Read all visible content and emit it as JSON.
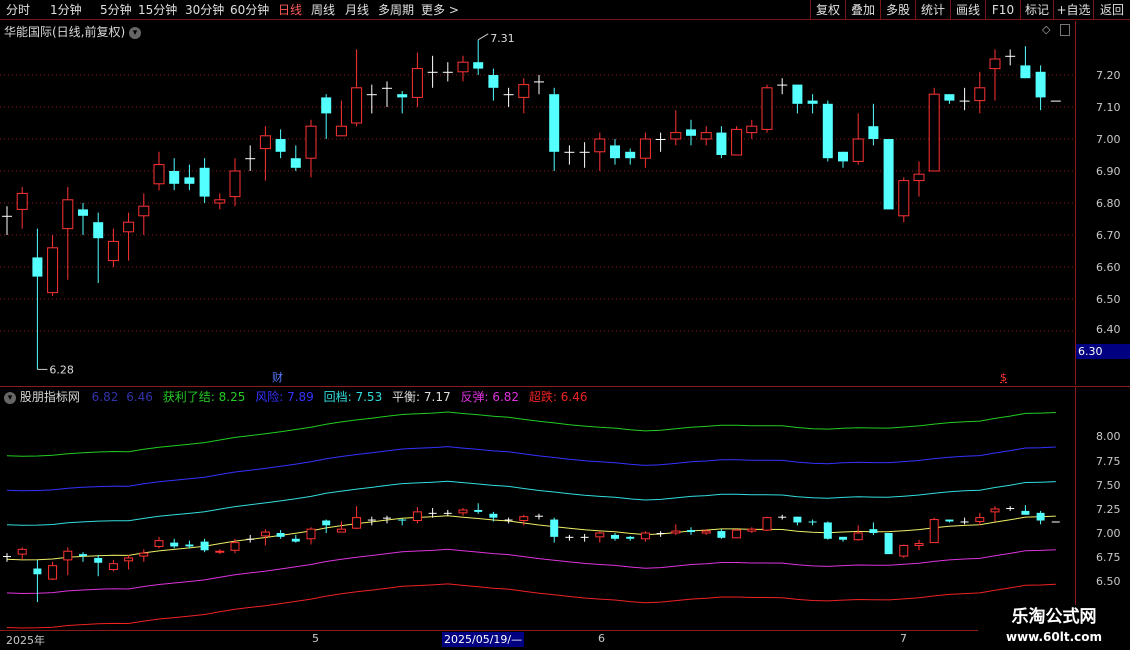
{
  "toolbar": {
    "periods": [
      "分时",
      "1分钟",
      "5分钟",
      "15分钟",
      "30分钟",
      "60分钟",
      "日线",
      "周线",
      "月线",
      "多周期",
      "更多 >"
    ],
    "active_period": "日线",
    "actions": [
      "复权",
      "叠加",
      "多股",
      "统计",
      "画线",
      "F10",
      "标记",
      "+自选",
      "返回"
    ]
  },
  "price_panel": {
    "title": "华能国际(日线,前复权)",
    "axis_labels": [
      "7.20",
      "7.10",
      "7.00",
      "6.90",
      "6.80",
      "6.70",
      "6.60",
      "6.50",
      "6.40"
    ],
    "cursor_value": "6.30",
    "high_label": "7.31",
    "low_label": "6.28",
    "marker_cai": "财",
    "marker_dollar": "$"
  },
  "indicator_panel": {
    "name": "股朋指标网",
    "pre_values": [
      "6.82",
      "6.46"
    ],
    "lines": [
      {
        "label": "获利了结",
        "value": "8.25",
        "color": "#22cc22"
      },
      {
        "label": "风险",
        "value": "7.89",
        "color": "#3333ff"
      },
      {
        "label": "回档",
        "value": "7.53",
        "color": "#33dddd"
      },
      {
        "label": "平衡",
        "value": "7.17",
        "color": "#dddd55"
      },
      {
        "label": "反弹",
        "value": "6.82",
        "color": "#dd33dd"
      },
      {
        "label": "超跌",
        "value": "6.46",
        "color": "#ee2222"
      }
    ],
    "axis_labels": [
      "8.00",
      "7.75",
      "7.50",
      "7.25",
      "7.00",
      "6.75",
      "6.50"
    ]
  },
  "date_bar": {
    "labels": [
      "2025年",
      "5",
      "6",
      "7"
    ],
    "cursor_date": "2025/05/19/—"
  },
  "watermark": {
    "line1": "乐淘公式网",
    "line2": "www.60lt.com"
  },
  "colors": {
    "up": "#ff3333",
    "down": "#54ffff",
    "doji": "#ffffff",
    "grid": "#8b1a1a"
  },
  "chart_data": {
    "type": "candlestick",
    "price_ylim": [
      6.28,
      7.31
    ],
    "candles": [
      {
        "o": 6.76,
        "c": 6.76,
        "h": 6.79,
        "l": 6.7
      },
      {
        "o": 6.78,
        "c": 6.83,
        "h": 6.85,
        "l": 6.72
      },
      {
        "o": 6.63,
        "c": 6.57,
        "h": 6.72,
        "l": 6.28
      },
      {
        "o": 6.52,
        "c": 6.66,
        "h": 6.7,
        "l": 6.51
      },
      {
        "o": 6.72,
        "c": 6.81,
        "h": 6.85,
        "l": 6.56
      },
      {
        "o": 6.78,
        "c": 6.76,
        "h": 6.8,
        "l": 6.7
      },
      {
        "o": 6.74,
        "c": 6.69,
        "h": 6.77,
        "l": 6.55
      },
      {
        "o": 6.62,
        "c": 6.68,
        "h": 6.72,
        "l": 6.6
      },
      {
        "o": 6.71,
        "c": 6.74,
        "h": 6.77,
        "l": 6.62
      },
      {
        "o": 6.76,
        "c": 6.79,
        "h": 6.83,
        "l": 6.7
      },
      {
        "o": 6.86,
        "c": 6.92,
        "h": 6.96,
        "l": 6.84
      },
      {
        "o": 6.9,
        "c": 6.86,
        "h": 6.94,
        "l": 6.84
      },
      {
        "o": 6.88,
        "c": 6.86,
        "h": 6.92,
        "l": 6.84
      },
      {
        "o": 6.91,
        "c": 6.82,
        "h": 6.94,
        "l": 6.8
      },
      {
        "o": 6.8,
        "c": 6.81,
        "h": 6.83,
        "l": 6.78
      },
      {
        "o": 6.82,
        "c": 6.9,
        "h": 6.94,
        "l": 6.79
      },
      {
        "o": 6.94,
        "c": 6.94,
        "h": 6.98,
        "l": 6.9
      },
      {
        "o": 6.97,
        "c": 7.01,
        "h": 7.04,
        "l": 6.87
      },
      {
        "o": 7.0,
        "c": 6.96,
        "h": 7.03,
        "l": 6.94
      },
      {
        "o": 6.94,
        "c": 6.91,
        "h": 6.98,
        "l": 6.9
      },
      {
        "o": 6.94,
        "c": 7.04,
        "h": 7.06,
        "l": 6.88
      },
      {
        "o": 7.13,
        "c": 7.08,
        "h": 7.14,
        "l": 7.0
      },
      {
        "o": 7.01,
        "c": 7.04,
        "h": 7.12,
        "l": 7.01
      },
      {
        "o": 7.05,
        "c": 7.16,
        "h": 7.28,
        "l": 7.04
      },
      {
        "o": 7.14,
        "c": 7.14,
        "h": 7.17,
        "l": 7.08
      },
      {
        "o": 7.16,
        "c": 7.16,
        "h": 7.18,
        "l": 7.1
      },
      {
        "o": 7.14,
        "c": 7.13,
        "h": 7.15,
        "l": 7.08
      },
      {
        "o": 7.13,
        "c": 7.22,
        "h": 7.27,
        "l": 7.1
      },
      {
        "o": 7.21,
        "c": 7.21,
        "h": 7.26,
        "l": 7.16
      },
      {
        "o": 7.21,
        "c": 7.21,
        "h": 7.24,
        "l": 7.18
      },
      {
        "o": 7.21,
        "c": 7.24,
        "h": 7.26,
        "l": 7.18
      },
      {
        "o": 7.24,
        "c": 7.22,
        "h": 7.31,
        "l": 7.2
      },
      {
        "o": 7.2,
        "c": 7.16,
        "h": 7.22,
        "l": 7.12
      },
      {
        "o": 7.14,
        "c": 7.14,
        "h": 7.16,
        "l": 7.1
      },
      {
        "o": 7.13,
        "c": 7.17,
        "h": 7.19,
        "l": 7.08
      },
      {
        "o": 7.18,
        "c": 7.18,
        "h": 7.2,
        "l": 7.14
      },
      {
        "o": 7.14,
        "c": 6.96,
        "h": 7.16,
        "l": 6.9
      },
      {
        "o": 6.96,
        "c": 6.96,
        "h": 6.98,
        "l": 6.92
      },
      {
        "o": 6.96,
        "c": 6.96,
        "h": 6.99,
        "l": 6.91
      },
      {
        "o": 6.96,
        "c": 7.0,
        "h": 7.02,
        "l": 6.9
      },
      {
        "o": 6.98,
        "c": 6.94,
        "h": 7.0,
        "l": 6.92
      },
      {
        "o": 6.96,
        "c": 6.94,
        "h": 6.97,
        "l": 6.92
      },
      {
        "o": 6.94,
        "c": 7.0,
        "h": 7.02,
        "l": 6.91
      },
      {
        "o": 7.0,
        "c": 7.0,
        "h": 7.02,
        "l": 6.96
      },
      {
        "o": 7.0,
        "c": 7.02,
        "h": 7.09,
        "l": 6.98
      },
      {
        "o": 7.03,
        "c": 7.01,
        "h": 7.06,
        "l": 6.98
      },
      {
        "o": 7.0,
        "c": 7.02,
        "h": 7.04,
        "l": 6.98
      },
      {
        "o": 7.02,
        "c": 6.95,
        "h": 7.04,
        "l": 6.94
      },
      {
        "o": 6.95,
        "c": 7.03,
        "h": 7.04,
        "l": 6.95
      },
      {
        "o": 7.02,
        "c": 7.04,
        "h": 7.06,
        "l": 7.0
      },
      {
        "o": 7.03,
        "c": 7.16,
        "h": 7.17,
        "l": 7.02
      },
      {
        "o": 7.17,
        "c": 7.17,
        "h": 7.19,
        "l": 7.14
      },
      {
        "o": 7.17,
        "c": 7.11,
        "h": 7.17,
        "l": 7.08
      },
      {
        "o": 7.12,
        "c": 7.11,
        "h": 7.14,
        "l": 7.08
      },
      {
        "o": 7.11,
        "c": 6.94,
        "h": 7.12,
        "l": 6.93
      },
      {
        "o": 6.96,
        "c": 6.93,
        "h": 6.96,
        "l": 6.91
      },
      {
        "o": 6.93,
        "c": 7.0,
        "h": 7.08,
        "l": 6.92
      },
      {
        "o": 7.04,
        "c": 7.0,
        "h": 7.11,
        "l": 6.98
      },
      {
        "o": 7.0,
        "c": 6.78,
        "h": 7.0,
        "l": 6.78
      },
      {
        "o": 6.76,
        "c": 6.87,
        "h": 6.88,
        "l": 6.74
      },
      {
        "o": 6.87,
        "c": 6.89,
        "h": 6.93,
        "l": 6.82
      },
      {
        "o": 6.9,
        "c": 7.14,
        "h": 7.16,
        "l": 6.9
      },
      {
        "o": 7.14,
        "c": 7.12,
        "h": 7.14,
        "l": 7.11
      },
      {
        "o": 7.12,
        "c": 7.12,
        "h": 7.16,
        "l": 7.09
      },
      {
        "o": 7.12,
        "c": 7.16,
        "h": 7.21,
        "l": 7.08
      },
      {
        "o": 7.22,
        "c": 7.25,
        "h": 7.28,
        "l": 7.12
      },
      {
        "o": 7.26,
        "c": 7.26,
        "h": 7.28,
        "l": 7.23
      },
      {
        "o": 7.23,
        "c": 7.19,
        "h": 7.29,
        "l": 7.19
      },
      {
        "o": 7.21,
        "c": 7.13,
        "h": 7.23,
        "l": 7.09
      },
      {
        "o": 7.12,
        "c": 7.12,
        "h": 7.12,
        "l": 7.12
      }
    ],
    "ind_ylim": [
      6.35,
      8.25
    ]
  }
}
